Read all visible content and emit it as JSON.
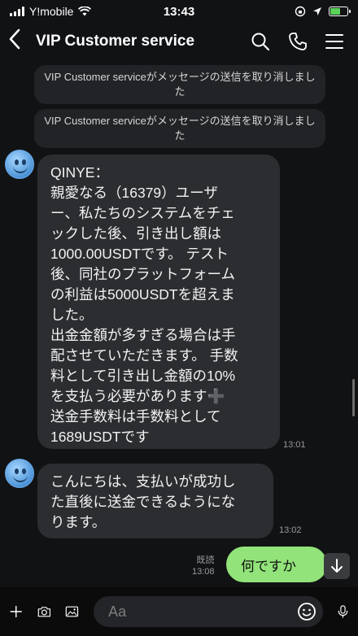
{
  "status": {
    "carrier": "Y!mobile",
    "time": "13:43"
  },
  "header": {
    "title": "VIP Customer service"
  },
  "system_messages": [
    "VIP Customer serviceがメッセージの送信を取り消しました",
    "VIP Customer serviceがメッセージの送信を取り消しました"
  ],
  "messages": [
    {
      "text": "QINYE：\n親愛なる（16379）ユーザ\nー、私たちのシステムをチェ\nックした後、引き出し額は\n1000.00USDTです。 テスト\n後、同社のプラットフォーム\nの利益は5000USDTを超えま\nした。\n出金金額が多すぎる場合は手\n配させていただきます。 手数\n料として引き出し金額の10%\nを支払う必要があります➕\n送金手数料は手数料として\n1689USDTです",
      "time": "13:01"
    },
    {
      "text": "こんにちは、支払いが成功し\nた直後に送金できるようにな\nります。",
      "time": "13:02"
    }
  ],
  "outgoing": {
    "text": "何ですか",
    "read_label": "既読",
    "time": "13:08"
  },
  "input": {
    "placeholder": "Aa"
  },
  "colors": {
    "background": "#111214",
    "bubble_in": "#2c2d30",
    "bubble_out": "#92e37a"
  }
}
